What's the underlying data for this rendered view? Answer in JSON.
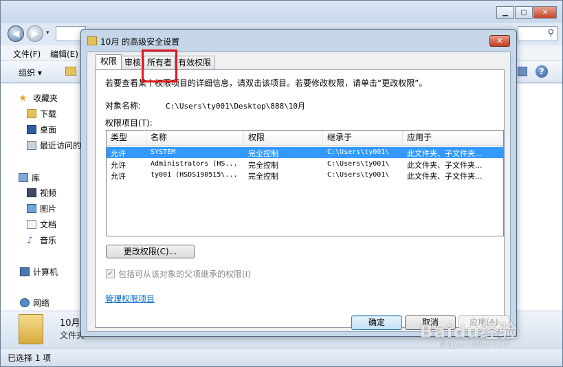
{
  "explorer": {
    "menu": [
      "文件(F)",
      "编辑(E)"
    ],
    "toolbar": {
      "organize": "组织 ▾"
    },
    "nav": {
      "favorites": "收藏夹",
      "downloads": "下载",
      "desktop": "桌面",
      "recent": "最近访问的",
      "libraries": "库",
      "videos": "视频",
      "pictures": "图片",
      "documents": "文档",
      "music": "音乐",
      "computer": "计算机",
      "network": "网络"
    },
    "details": {
      "name": "10月",
      "type": "文件夹"
    },
    "status": "已选择 1 项"
  },
  "dialog": {
    "title": "10月 的高级安全设置",
    "tabs": [
      {
        "label": "权限",
        "active": true
      },
      {
        "label": "审核",
        "active": false
      },
      {
        "label": "所有者",
        "active": false,
        "highlighted": true
      },
      {
        "label": "有效权限",
        "active": false
      }
    ],
    "info_text": "若要查看某个权限项目的详细信息，请双击该项目。若要修改权限，请单击“更改权限”。",
    "object_label": "对象名称:",
    "object_value": "C:\\Users\\ty001\\Desktop\\888\\10月",
    "entries_label": "权限项目(T):",
    "table": {
      "headers": [
        "类型",
        "名称",
        "权限",
        "继承于",
        "应用于"
      ],
      "rows": [
        [
          "允许",
          "SYSTEM",
          "完全控制",
          "C:\\Users\\ty001\\",
          "此文件夹、子文件夹..."
        ],
        [
          "允许",
          "Administrators (HS...",
          "完全控制",
          "C:\\Users\\ty001\\",
          "此文件夹、子文件夹..."
        ],
        [
          "允许",
          "ty001 (HSDS190515\\...",
          "完全控制",
          "C:\\Users\\ty001\\",
          "此文件夹、子文件夹..."
        ]
      ],
      "selected_row": 0
    },
    "change_button": "更改权限(C)...",
    "inherit_checkbox": {
      "label": "包括可从该对象的父项继承的权限(I)",
      "checked": true,
      "disabled": true
    },
    "manage_link": "管理权限项目",
    "buttons": {
      "ok": "确定",
      "cancel": "取消",
      "apply": "应用(A)"
    }
  },
  "watermark": {
    "main": "Baidu经验",
    "sub": "jingyan.baidu.com"
  },
  "colors": {
    "selection": "#3399ff",
    "highlight_box": "#e3161c",
    "link": "#0066cc"
  }
}
